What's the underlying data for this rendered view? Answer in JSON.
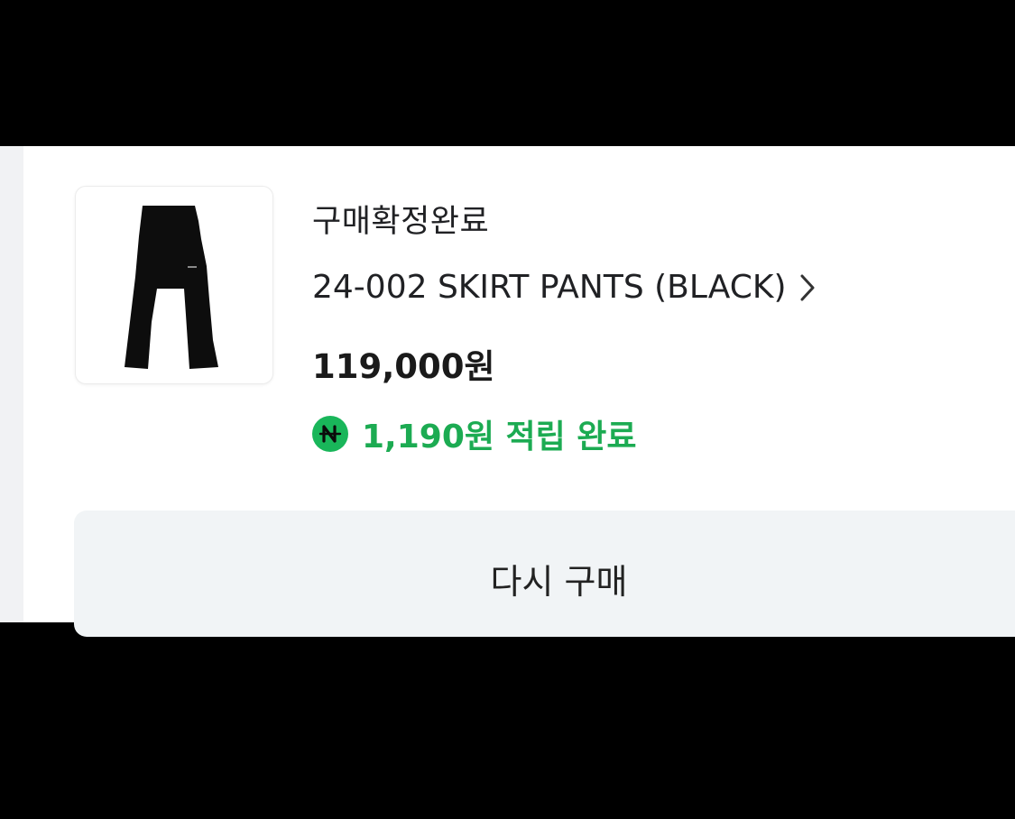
{
  "order": {
    "status": "구매확정완료",
    "product_name": "24-002 SKIRT PANTS (BLACK)",
    "price": "119,000원",
    "reward": {
      "badge_icon": "naver-pay-icon",
      "text": "1,190원 적립 완료",
      "color": "#1cab52"
    },
    "thumbnail_icon": "skirt-pants-image",
    "chevron_icon": "chevron-right-icon"
  },
  "actions": {
    "rebuy_label": "다시 구매"
  },
  "colors": {
    "frame_background": "#000000",
    "card_background": "#ffffff",
    "button_background": "#f1f4f6",
    "accent_green": "#19b65a"
  }
}
